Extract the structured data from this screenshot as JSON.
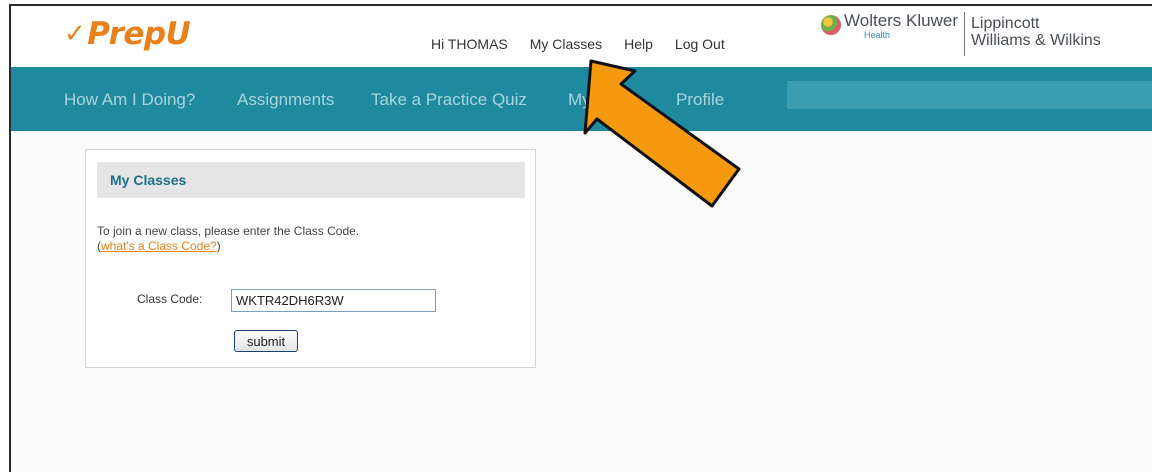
{
  "logo": {
    "check": "✓",
    "text": "PrepU"
  },
  "top_nav": {
    "greeting": "Hi THOMAS",
    "my_classes": "My Classes",
    "help": "Help",
    "logout": "Log Out"
  },
  "brand": {
    "wolters_kluwer": "Wolters Kluwer",
    "health": "Health",
    "lippincott": "Lippincott",
    "williams_wilkins": "Williams & Wilkins"
  },
  "main_nav": {
    "how_am_i_doing": "How Am I Doing?",
    "assignments": "Assignments",
    "practice_quiz": "Take a Practice Quiz",
    "my_prefix": "My",
    "profile": "Profile"
  },
  "panel": {
    "title": "My Classes",
    "instruction": "To join a new class, please enter the Class Code.",
    "open_paren": "(",
    "help_link": "what's a Class Code?",
    "close_paren": ")",
    "class_code_label": "Class Code:",
    "class_code_value": "WKTR42DH6R3W",
    "submit_label": "submit"
  },
  "colors": {
    "brand_orange": "#e8801b",
    "nav_teal": "#1f8a9f",
    "annotation_arrow": "#f59a0f"
  }
}
